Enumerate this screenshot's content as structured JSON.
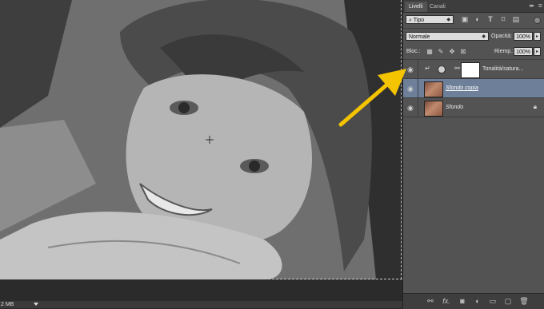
{
  "status": {
    "doc_size": "2 MB"
  },
  "panel": {
    "tabs": [
      "Livelli",
      "Canali"
    ],
    "filter": {
      "kind": "Tipo"
    },
    "blend_mode": "Normale",
    "opacity_label": "Opacità:",
    "opacity_value": "100%",
    "lock_label": "Bloc.:",
    "fill_label": "Riemp.:",
    "fill_value": "100%",
    "layers": [
      {
        "name": "Tonalità/satura...",
        "type": "adjustment",
        "visible": true,
        "clipped": true
      },
      {
        "name": "Sfondo copia",
        "type": "pixel",
        "visible": true,
        "selected": true
      },
      {
        "name": "Sfondo",
        "type": "pixel",
        "visible": true,
        "locked": true
      }
    ]
  },
  "colors": {
    "panel_bg": "#535353",
    "selected_layer": "#6e7f99",
    "annotation_arrow": "#f5c400"
  },
  "icons": {
    "filter": [
      "image-filter-icon",
      "adjustment-filter-icon",
      "type-filter-icon",
      "shape-filter-icon",
      "smart-object-filter-icon"
    ],
    "lock": [
      "lock-transparency-icon",
      "lock-pixels-icon",
      "lock-position-icon",
      "lock-all-icon"
    ],
    "bottom": [
      "link-layers-icon",
      "fx-icon",
      "add-mask-icon",
      "new-adjustment-icon",
      "new-group-icon",
      "new-layer-icon",
      "trash-icon"
    ]
  }
}
